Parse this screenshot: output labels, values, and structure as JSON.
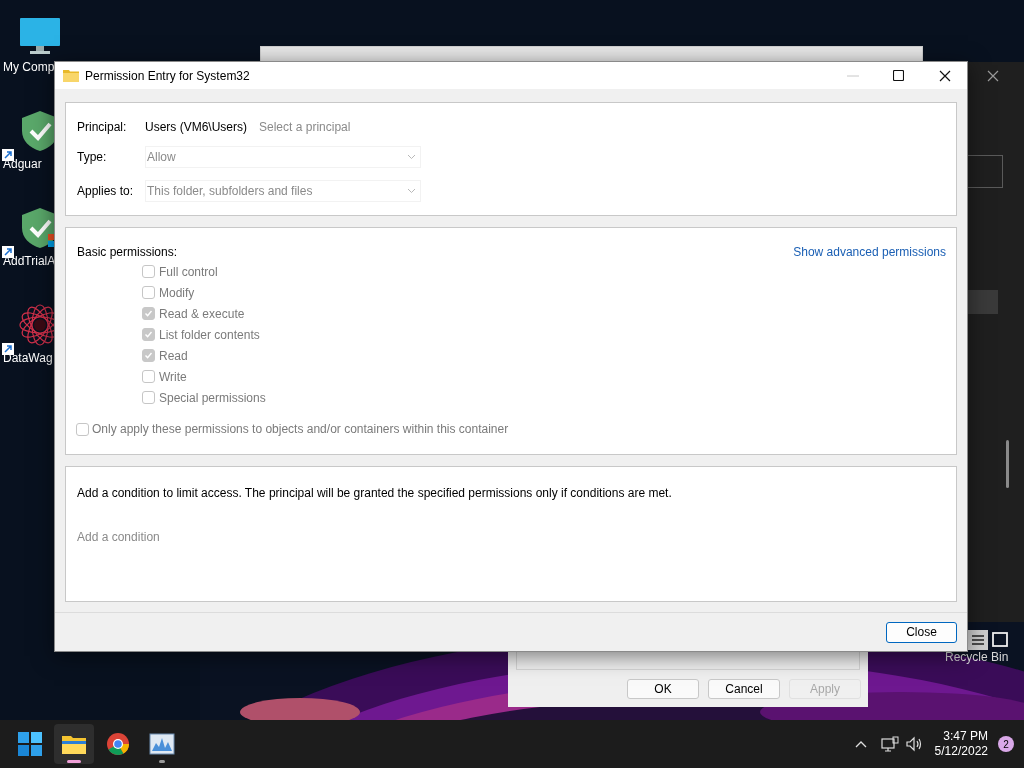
{
  "desktop_icons": [
    {
      "label": "My Comp",
      "kind": "monitor"
    },
    {
      "label": "Adguar",
      "kind": "shield"
    },
    {
      "label": "AddTrialA",
      "kind": "shield-flag"
    },
    {
      "label": "DataWag",
      "kind": "web"
    }
  ],
  "side_window": {
    "caption": "Recycle Bin"
  },
  "properties_dialog": {
    "buttons": [
      {
        "label": "OK",
        "disabled": false
      },
      {
        "label": "Cancel",
        "disabled": false
      },
      {
        "label": "Apply",
        "disabled": true
      }
    ]
  },
  "dialog": {
    "title": "Permission Entry for System32",
    "principal": {
      "label": "Principal:",
      "value": "Users (VM6\\Users)",
      "link": "Select a principal"
    },
    "fields": [
      {
        "label": "Type:",
        "value": "Allow",
        "disabled": true
      },
      {
        "label": "Applies to:",
        "value": "This folder, subfolders and files",
        "disabled": true
      }
    ],
    "permissions": {
      "heading": "Basic permissions:",
      "link": "Show advanced permissions",
      "items": [
        {
          "label": "Full control",
          "checked": false,
          "disabled": true
        },
        {
          "label": "Modify",
          "checked": false,
          "disabled": true
        },
        {
          "label": "Read & execute",
          "checked": true,
          "disabled": true
        },
        {
          "label": "List folder contents",
          "checked": true,
          "disabled": true
        },
        {
          "label": "Read",
          "checked": true,
          "disabled": true
        },
        {
          "label": "Write",
          "checked": false,
          "disabled": true
        },
        {
          "label": "Special permissions",
          "checked": false,
          "disabled": true
        }
      ]
    },
    "only_apply": {
      "label": "Only apply these permissions to objects and/or containers within this container",
      "checked": false,
      "disabled": true
    },
    "condition": {
      "text": "Add a condition to limit access. The principal will be granted the specified permissions only if conditions are met.",
      "link": "Add a condition"
    },
    "close_button": "Close"
  },
  "taskbar": {
    "apps": [
      {
        "kind": "start",
        "selected": false,
        "running": false
      },
      {
        "kind": "explorer",
        "selected": true,
        "running": true
      },
      {
        "kind": "chrome",
        "selected": false,
        "running": false
      },
      {
        "kind": "monitor",
        "selected": false,
        "running": true
      }
    ],
    "time": "3:47 PM",
    "date": "5/12/2022",
    "notifications": "2"
  }
}
